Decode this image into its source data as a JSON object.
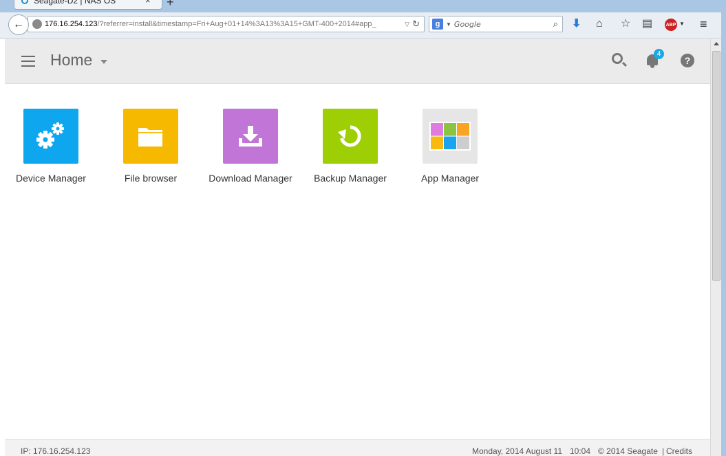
{
  "browser": {
    "tab_title": "Seagate-D2 | NAS OS",
    "tab_close": "×",
    "new_tab": "+",
    "url_host": "176.16.254.123",
    "url_path": "/?referrer=install&timestamp=Fri+Aug+01+14%3A13%3A15+GMT-400+2014#app_",
    "search_engine_letter": "g",
    "search_placeholder": "Google",
    "toolbar_icons": [
      "back-arrow-icon",
      "globe-icon",
      "reload-icon",
      "search-icon",
      "download-icon",
      "home-icon",
      "bookmark-star-icon",
      "reading-list-icon",
      "adblock-icon",
      "menu-icon"
    ],
    "adblock_label": "ABP"
  },
  "header": {
    "title": "Home",
    "notification_count": "4",
    "help_label": "?"
  },
  "apps": [
    {
      "label": "Device Manager",
      "color": "#0ea7ef",
      "icon": "gears-icon"
    },
    {
      "label": "File browser",
      "color": "#f6b900",
      "icon": "folder-icon"
    },
    {
      "label": "Download Manager",
      "color": "#c175d6",
      "icon": "download-tray-icon"
    },
    {
      "label": "Backup Manager",
      "color": "#9ecf05",
      "icon": "backup-restore-icon"
    },
    {
      "label": "App Manager",
      "color": "#e6e6e6",
      "icon": "app-grid-icon"
    }
  ],
  "app_grid_colors": [
    "#de7ce0",
    "#8bc43f",
    "#f9a521",
    "#f9b90e",
    "#1aa4ef",
    "#cdcdcd"
  ],
  "footer": {
    "ip": "IP: 176.16.254.123",
    "date": "Monday, 2014 August 11",
    "time": "10:04",
    "copyright": "© 2014 Seagate",
    "separator": "|",
    "credits": "Credits"
  }
}
